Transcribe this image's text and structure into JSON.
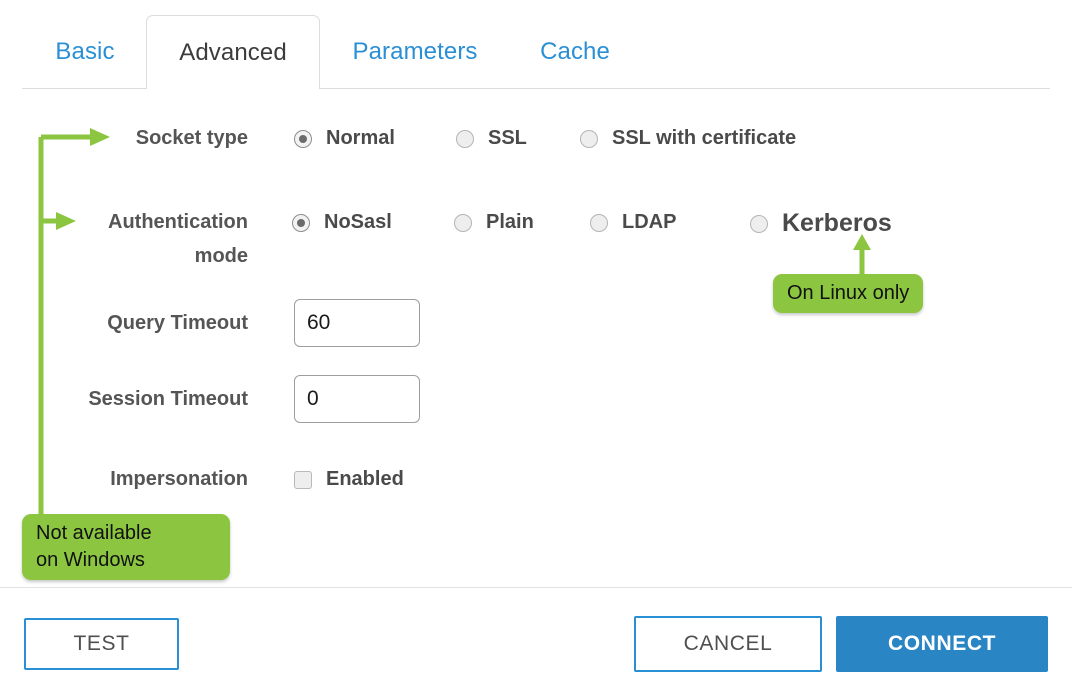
{
  "tabs": [
    {
      "id": "basic",
      "label": "Basic",
      "active": false
    },
    {
      "id": "advanced",
      "label": "Advanced",
      "active": true
    },
    {
      "id": "parameters",
      "label": "Parameters",
      "active": false
    },
    {
      "id": "cache",
      "label": "Cache",
      "active": false
    }
  ],
  "form": {
    "socket_type": {
      "label": "Socket type",
      "selected": "Normal",
      "options": [
        {
          "label": "Normal",
          "checked": true
        },
        {
          "label": "SSL",
          "checked": false
        },
        {
          "label": "SSL with certificate",
          "checked": false
        }
      ]
    },
    "authentication_mode": {
      "label": "Authentication mode",
      "label_line1": "Authentication",
      "label_line2": "mode",
      "selected": "NoSasl",
      "options": [
        {
          "label": "NoSasl",
          "checked": true
        },
        {
          "label": "Plain",
          "checked": false
        },
        {
          "label": "LDAP",
          "checked": false
        },
        {
          "label": "Kerberos",
          "checked": false
        }
      ]
    },
    "query_timeout": {
      "label": "Query Timeout",
      "value": "60",
      "placeholder": ""
    },
    "session_timeout": {
      "label": "Session Timeout",
      "value": "0",
      "placeholder": ""
    },
    "impersonation": {
      "label": "Impersonation",
      "option_label": "Enabled",
      "checked": false
    }
  },
  "annotations": {
    "accent_color": "#8cc640",
    "windows_note": "Not available\non Windows",
    "linux_note": "On Linux only"
  },
  "footer": {
    "test_label": "TEST",
    "cancel_label": "CANCEL",
    "connect_label": "CONNECT",
    "connect_color": "#2a85c4",
    "outline_color": "#2a8fd4"
  }
}
